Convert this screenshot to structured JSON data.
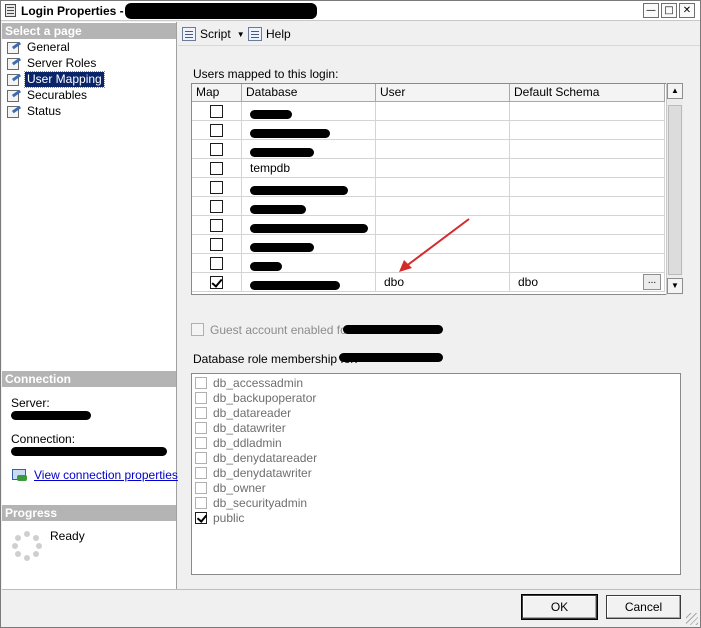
{
  "window": {
    "title": "Login Properties - "
  },
  "left_panel": {
    "select_page_header": "Select a page",
    "pages": [
      {
        "label": "General"
      },
      {
        "label": "Server Roles"
      },
      {
        "label": "User Mapping",
        "selected": true
      },
      {
        "label": "Securables"
      },
      {
        "label": "Status"
      }
    ],
    "connection_header": "Connection",
    "server_label": "Server:",
    "connection_label": "Connection:",
    "view_connection_link": "View connection properties",
    "progress_header": "Progress",
    "progress_status": "Ready"
  },
  "toolbar": {
    "script_label": "Script",
    "help_label": "Help"
  },
  "mapped_users": {
    "label": "Users mapped to this login:",
    "columns": [
      "Map",
      "Database",
      "User",
      "Default Schema"
    ],
    "rows": [
      {
        "mapped": false,
        "database": "",
        "user": "",
        "schema": ""
      },
      {
        "mapped": false,
        "database": "",
        "user": "",
        "schema": ""
      },
      {
        "mapped": false,
        "database": "",
        "user": "",
        "schema": ""
      },
      {
        "mapped": false,
        "database": "tempdb",
        "user": "",
        "schema": ""
      },
      {
        "mapped": false,
        "database": "",
        "user": "",
        "schema": ""
      },
      {
        "mapped": false,
        "database": "",
        "user": "",
        "schema": ""
      },
      {
        "mapped": false,
        "database": "",
        "user": "",
        "schema": ""
      },
      {
        "mapped": false,
        "database": "",
        "user": "",
        "schema": ""
      },
      {
        "mapped": false,
        "database": "",
        "user": "",
        "schema": ""
      },
      {
        "mapped": true,
        "database": "",
        "user": "dbo",
        "schema": "dbo",
        "ellipsis": "..."
      }
    ]
  },
  "guest": {
    "label": "Guest account enabled for:",
    "checked": false
  },
  "roles": {
    "label": "Database role membership for:",
    "items": [
      {
        "name": "db_accessadmin",
        "checked": false
      },
      {
        "name": "db_backupoperator",
        "checked": false
      },
      {
        "name": "db_datareader",
        "checked": false
      },
      {
        "name": "db_datawriter",
        "checked": false
      },
      {
        "name": "db_ddladmin",
        "checked": false
      },
      {
        "name": "db_denydatareader",
        "checked": false
      },
      {
        "name": "db_denydatawriter",
        "checked": false
      },
      {
        "name": "db_owner",
        "checked": false
      },
      {
        "name": "db_securityadmin",
        "checked": false
      },
      {
        "name": "public",
        "checked": true
      }
    ]
  },
  "buttons": {
    "ok": "OK",
    "cancel": "Cancel"
  },
  "colors": {
    "annotation_arrow": "#d42a2a",
    "section_header": "#b4b4b4",
    "selection": "#0a246a",
    "link": "#0000cc"
  }
}
